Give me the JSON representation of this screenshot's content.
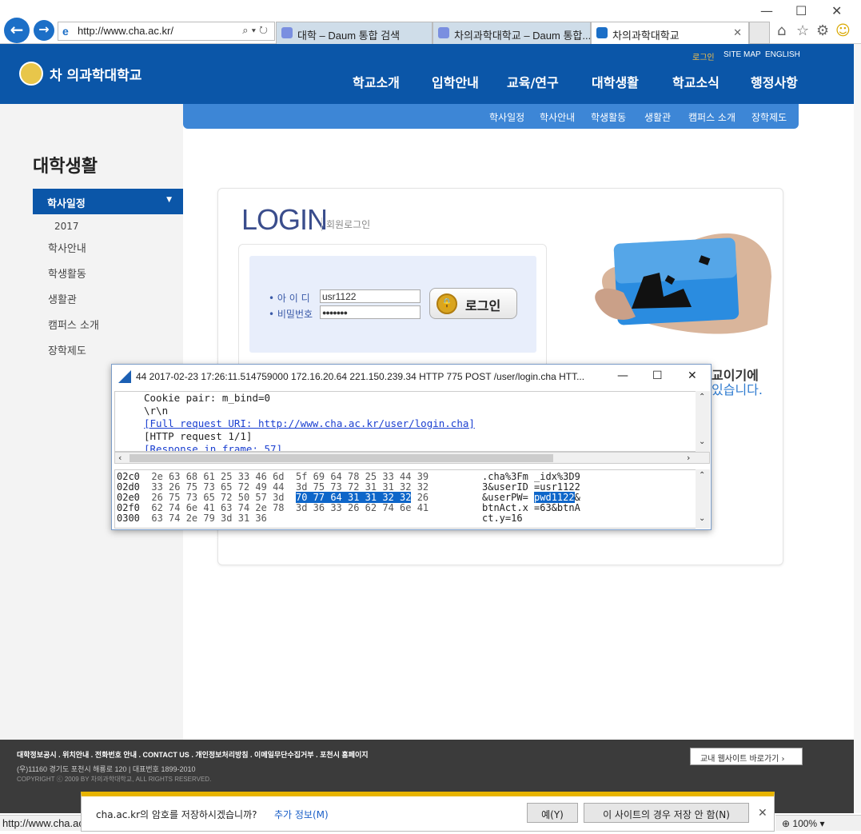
{
  "browser": {
    "url": "http://www.cha.ac.kr/",
    "tabs": [
      {
        "label": "대학 – Daum 통합 검색"
      },
      {
        "label": "차의과학대학교 – Daum 통합..."
      },
      {
        "label": "차의과학대학교"
      }
    ],
    "status_url": "http://www.cha.ac",
    "zoom": "100%"
  },
  "site": {
    "logo_text": "차 의과학대학교",
    "top_links": [
      "로그인",
      "SITE MAP",
      "ENGLISH"
    ],
    "gnb": [
      "학교소개",
      "입학안내",
      "교육/연구",
      "대학생활",
      "학교소식",
      "행정사항"
    ],
    "subnav": [
      "학사일정",
      "학사안내",
      "학생활동",
      "생활관",
      "캠퍼스 소개",
      "장학제도"
    ],
    "left_title": "대학생활",
    "left_active": "학사일정",
    "left_year": "2017",
    "left_menu": [
      "학사안내",
      "학생활동",
      "생활관",
      "캠퍼스 소개",
      "장학제도"
    ]
  },
  "login": {
    "title": "LOGIN",
    "subtitle": "회원로그인",
    "id_label": "• 아 이 디",
    "pw_label": "• 비밀번호",
    "id_value": "usr1122",
    "pw_value": "●●●●●●●",
    "button": "로그인",
    "promo_line1": "교이기에",
    "promo_line2": "있습니다."
  },
  "wireshark": {
    "title": "44 2017-02-23 17:26:11.514759000 172.16.20.64 221.150.239.34 HTTP 775 POST /user/login.cha HTT...",
    "detail": [
      "  Cookie pair: m_bind=0",
      "\\r\\n",
      "[Full request URI: http://www.cha.ac.kr/user/login.cha]",
      "[HTTP request 1/1]",
      "[Response in frame: 57]"
    ],
    "hex": [
      {
        "off": "02c0",
        "bytes": "2e 63 68 61 25 33 46 6d  5f 69 64 78 25 33 44 39",
        "ascii": ".cha%3Fm _idx%3D9"
      },
      {
        "off": "02d0",
        "bytes": "33 26 75 73 65 72 49 44  3d 75 73 72 31 31 32 32",
        "ascii": "3&userID =usr1122"
      },
      {
        "off": "02e0",
        "bytes_a": "26 75 73 65 72 50 57 3d  ",
        "bytes_hl": "70 77 64 31 31 32 32",
        "bytes_b": " 26",
        "ascii_a": "&userPW= ",
        "ascii_hl": "pwd1122",
        "ascii_b": "&"
      },
      {
        "off": "02f0",
        "bytes": "62 74 6e 41 63 74 2e 78  3d 36 33 26 62 74 6e 41",
        "ascii": "btnAct.x =63&btnA"
      },
      {
        "off": "0300",
        "bytes": "63 74 2e 79 3d 31 36",
        "ascii": "ct.y=16"
      }
    ]
  },
  "footer": {
    "links": "대학정보공시 . 위치안내 . 전화번호 안내 . CONTACT US . 개인정보처리방침 . 이메일무단수집거부 . 포천시 홈페이지",
    "address": "(우)11160 경기도 포천시 해룡로 120 | 대표번호 1899-2010",
    "copyright": "COPYRIGHT ⓒ 2009 BY 차의과학대학교, ALL RIGHTS RESERVED.",
    "shortcut_button": "교내 웹사이트 바로가기"
  },
  "password_bar": {
    "question": "cha.ac.kr의 암호를 저장하시겠습니까?",
    "more": "추가 정보(M)",
    "yes": "예(Y)",
    "never": "이 사이트의 경우 저장 안 함(N)"
  },
  "colors": {
    "brand": "#0b56a8",
    "accent": "#e8b400"
  }
}
